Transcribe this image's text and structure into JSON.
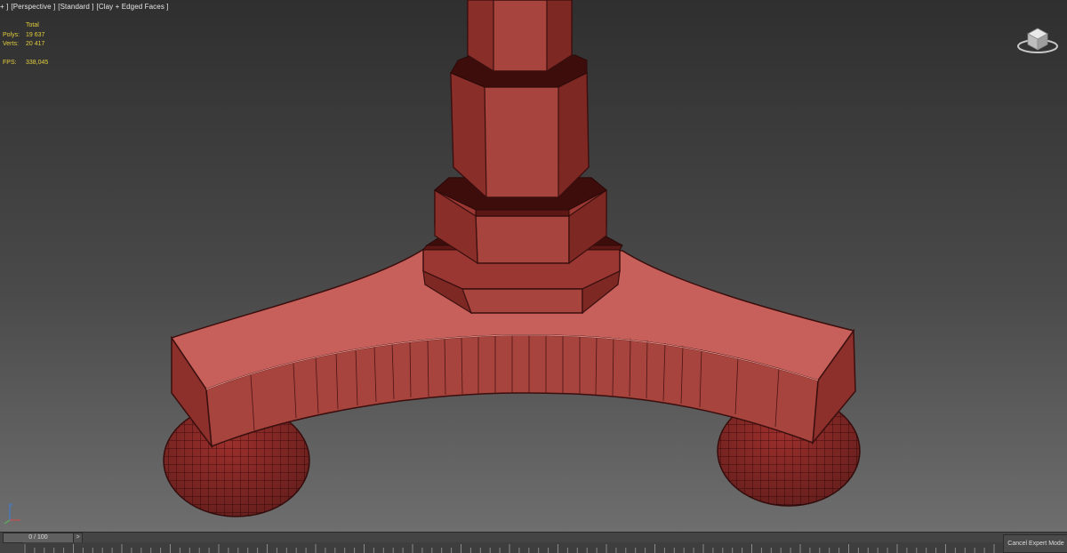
{
  "viewport": {
    "label_parts": [
      "+ ]",
      "[Perspective ]",
      "[Standard ]",
      "[Clay + Edged Faces ]"
    ]
  },
  "stats": {
    "header": "Total",
    "polys_label": "Polys:",
    "polys_value": "19 637",
    "verts_label": "Verts:",
    "verts_value": "20 417",
    "fps_label": "FPS:",
    "fps_value": "338,045"
  },
  "timeline": {
    "frame_display": "0 / 100",
    "next_label": ">",
    "cancel_expert_label": "Cancel Expert Mode"
  },
  "colors": {
    "model_red": "#a8443e",
    "wire": "#3a0f0e",
    "stats_yellow": "#e2cd3c",
    "viewport_bg": "#3f3f3f"
  },
  "icons": [
    "viewcube-icon",
    "axis-tripod-icon"
  ]
}
